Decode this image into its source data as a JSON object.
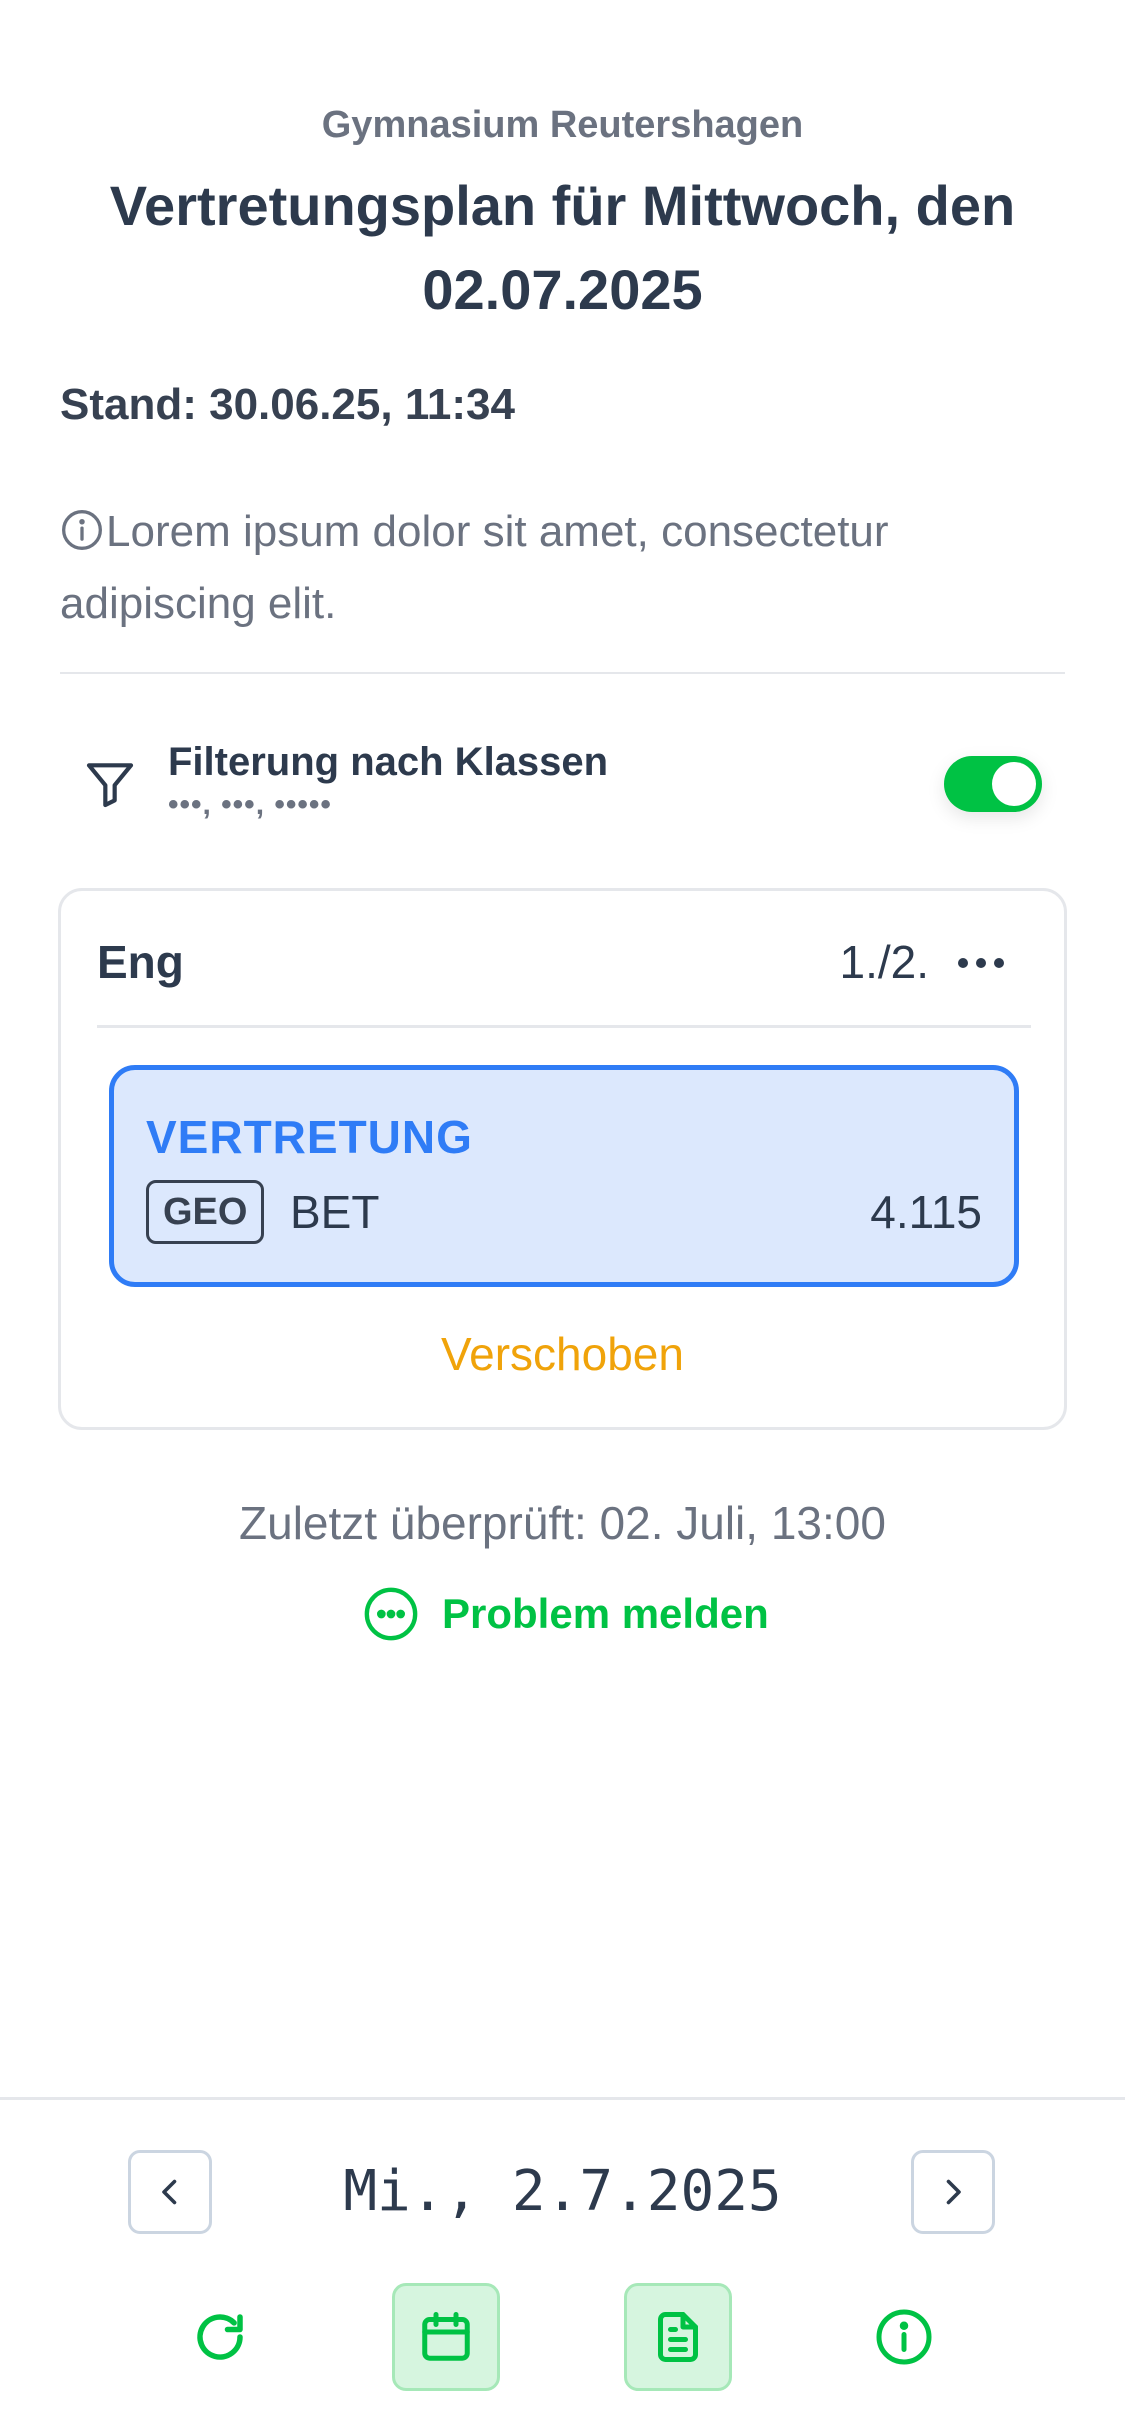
{
  "header": {
    "school": "Gymnasium Reutershagen",
    "title": "Vertretungsplan für Mittwoch, den 02.07.2025"
  },
  "stand": "Stand: 30.06.25, 11:34",
  "info": {
    "icon": "info-circle-icon",
    "text": "Lorem ipsum dolor sit amet, consectetur adipiscing elit."
  },
  "filter": {
    "icon": "funnel-icon",
    "title": "Filterung nach Klassen",
    "subtitle": "•••, •••, •••••",
    "enabled": true
  },
  "entry": {
    "subject": "Eng",
    "period": "1./2.",
    "more_icon": "more-horizontal-icon",
    "substitution": {
      "type": "VERTRETUNG",
      "badge": "GEO",
      "teacher": "BET",
      "room": "4.115"
    },
    "status": "Verschoben"
  },
  "last_checked": "Zuletzt überprüft: 02. Juli, 13:00",
  "report": {
    "icon": "message-circle-dots-icon",
    "label": "Problem melden"
  },
  "bottom": {
    "date": "Mi., 2.7.2025",
    "prev_icon": "chevron-left-icon",
    "next_icon": "chevron-right-icon",
    "tools": [
      "refresh-icon",
      "calendar-icon",
      "document-icon",
      "info-icon"
    ]
  },
  "colors": {
    "accent_green": "#00c244",
    "substitution_blue": "#2f7cf6",
    "substitution_bg": "#dce8fd",
    "status_orange": "#f0a30a",
    "text_dark": "#2d3a4d",
    "text_muted": "#6b7280"
  }
}
